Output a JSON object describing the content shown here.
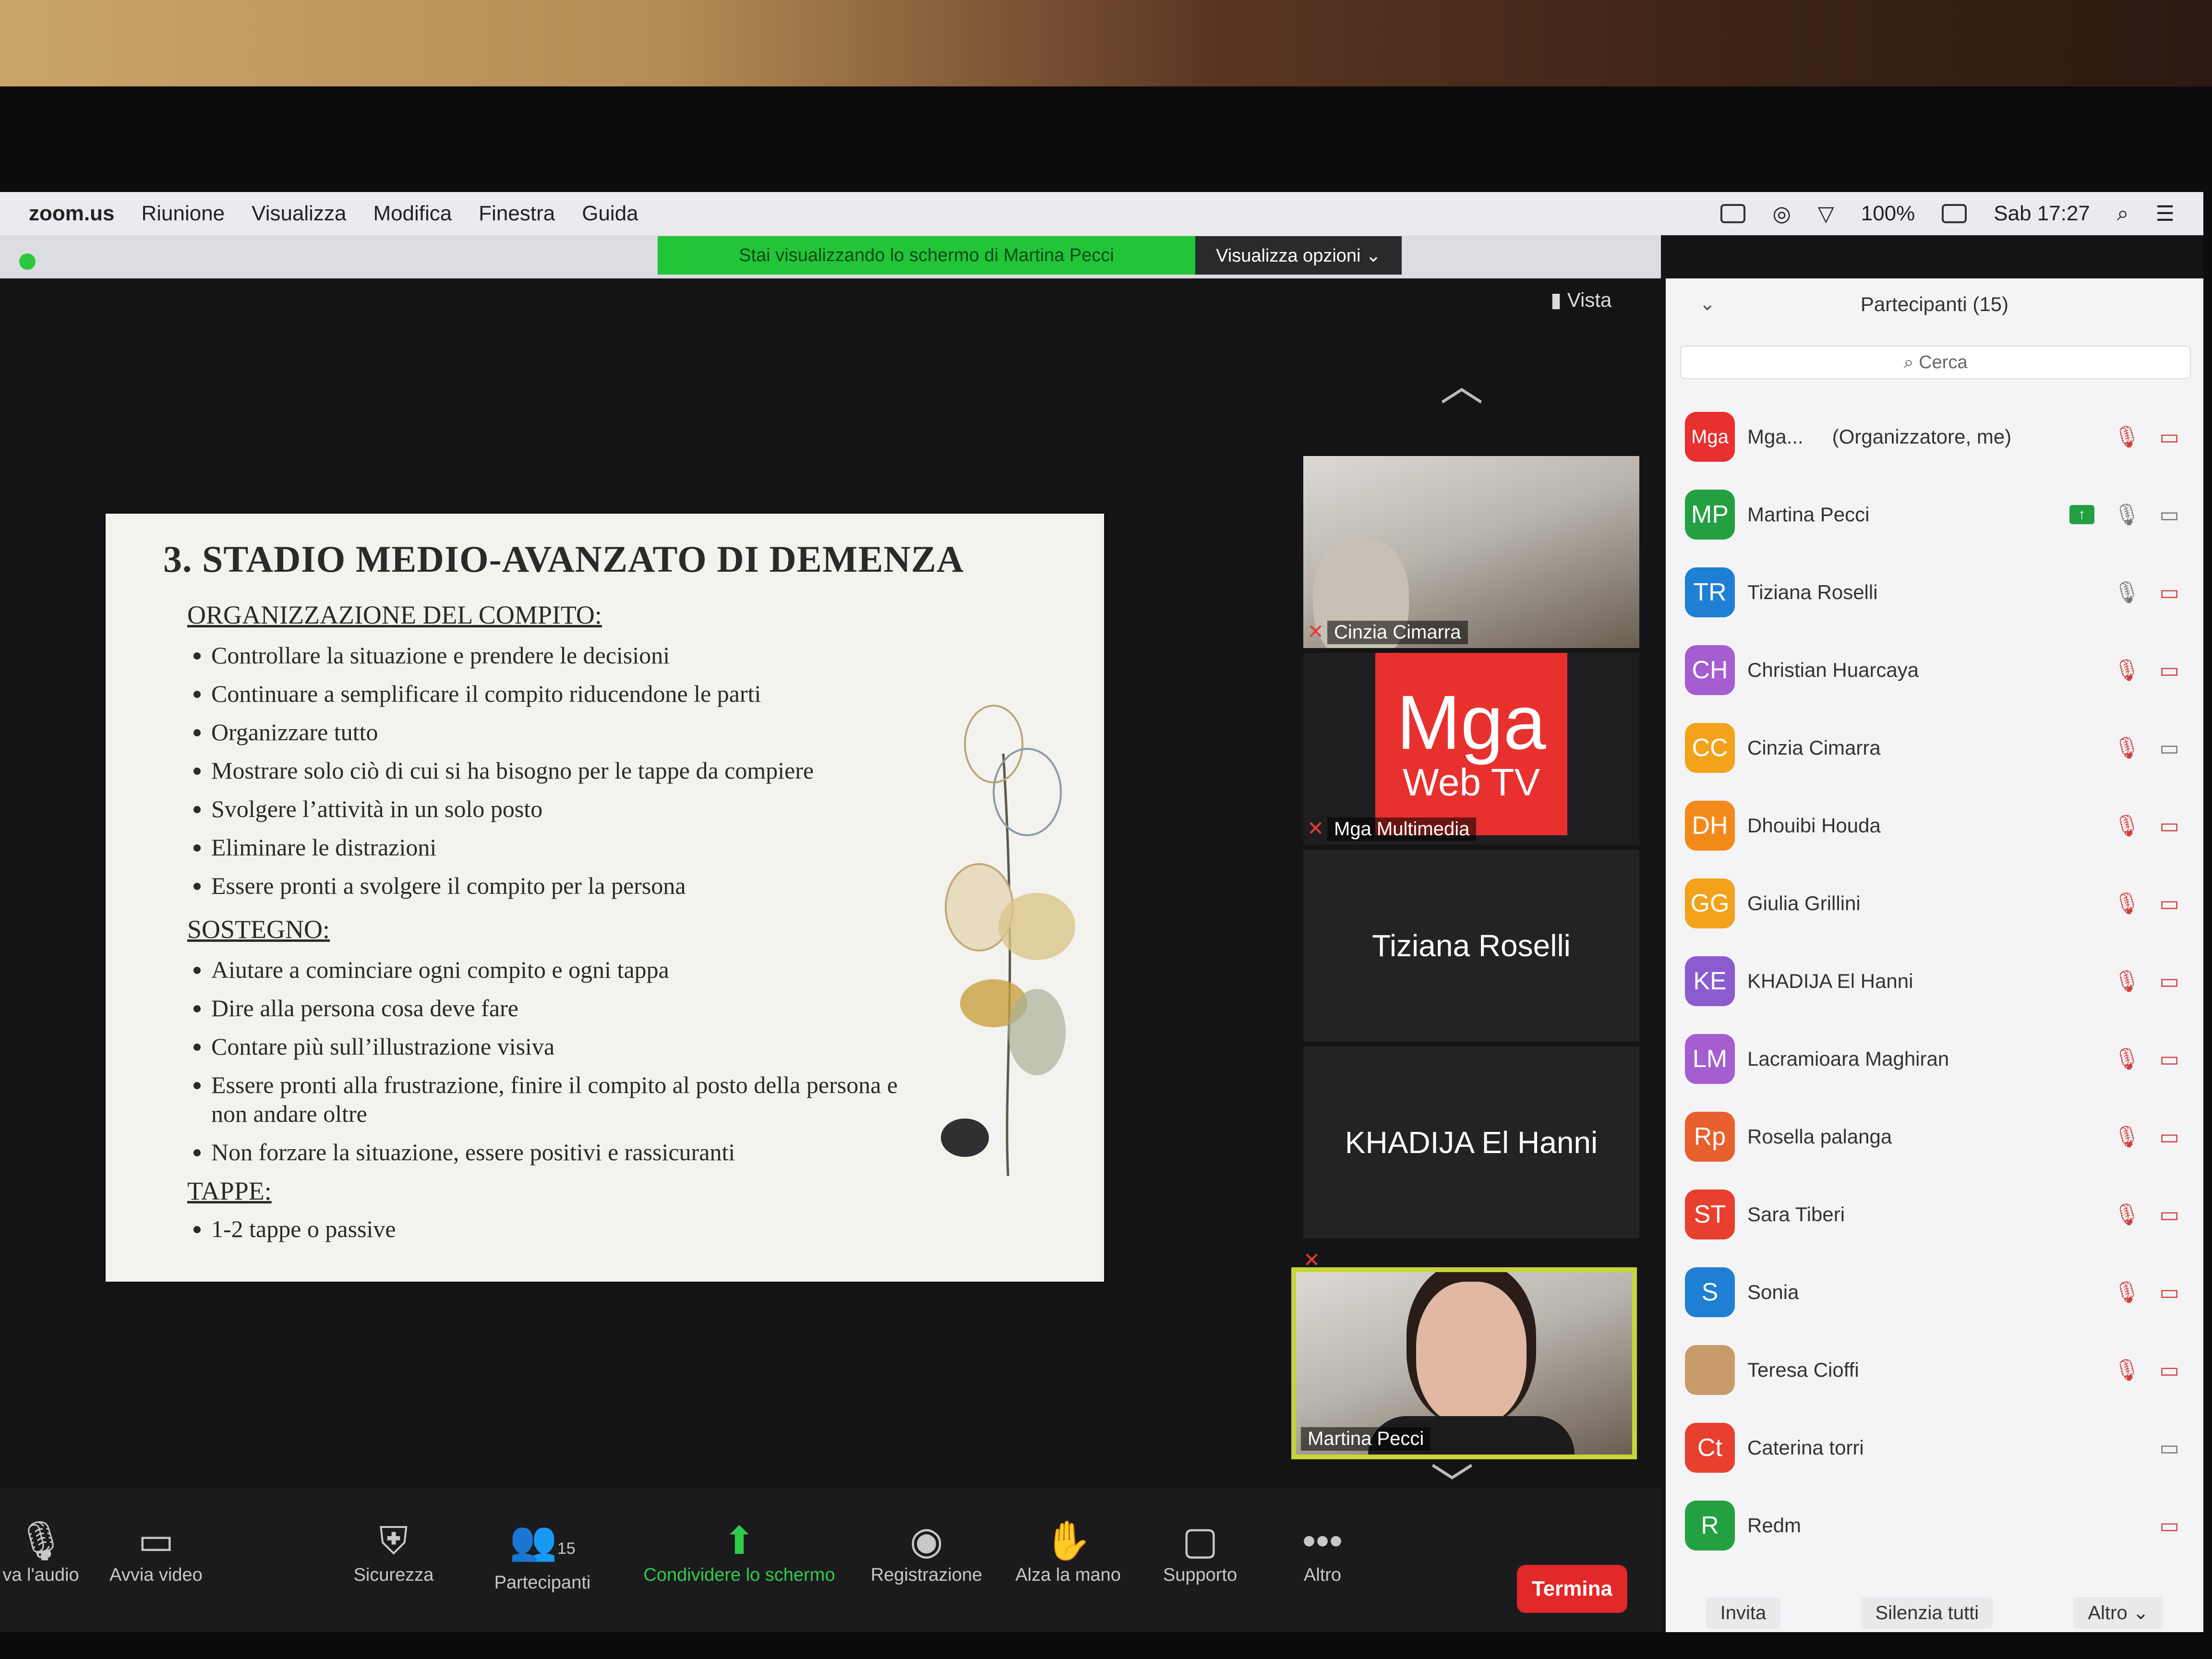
{
  "menubar": {
    "app": "zoom.us",
    "items": [
      "Riunione",
      "Visualizza",
      "Modifica",
      "Finestra",
      "Guida"
    ],
    "battery": "100%",
    "clock": "Sab 17:27"
  },
  "share_banner": "Stai visualizzando lo schermo di Martina Pecci",
  "view_options": "Visualizza opzioni ⌄",
  "vista_label": "Vista",
  "slide": {
    "title": "3. STADIO MEDIO-AVANZATO DI DEMENZA",
    "sections": [
      {
        "heading": "ORGANIZZAZIONE DEL COMPITO:",
        "bullets": [
          "Controllare la situazione e prendere le decisioni",
          "Continuare a semplificare il compito riducendone le parti",
          "Organizzare tutto",
          "Mostrare solo ciò di cui si ha bisogno per le tappe da compiere",
          "Svolgere l’attività in un solo posto",
          "Eliminare le distrazioni",
          "Essere pronti a svolgere il compito per la persona"
        ]
      },
      {
        "heading": "SOSTEGNO:",
        "bullets": [
          "Aiutare a cominciare ogni compito e ogni tappa",
          "Dire alla persona cosa deve fare",
          "Contare più sull’illustrazione visiva",
          "Essere pronti alla frustrazione, finire il compito al posto della persona e non andare oltre",
          "Non forzare la situazione, essere positivi e rassicuranti"
        ]
      },
      {
        "heading": "TAPPE:",
        "bullets": [
          "1-2 tappe o passive"
        ]
      }
    ]
  },
  "tiles": {
    "t1": "Cinzia Cimarra",
    "t2_logo_1": "Mga",
    "t2_logo_2": "Web TV",
    "t2": "Mga Multimedia",
    "t3": "Tiziana Roselli",
    "t4": "KHADIJA El Hanni",
    "t5": "Martina Pecci"
  },
  "panel": {
    "title": "Partecipanti (15)",
    "search_placeholder": "Cerca",
    "participants": [
      {
        "initials": "Mga",
        "name": "Mga...",
        "role": "(Organizzatore, me)",
        "color": "#e8302e"
      },
      {
        "initials": "MP",
        "name": "Martina Pecci",
        "color": "#23a042"
      },
      {
        "initials": "TR",
        "name": "Tiziana Roselli",
        "color": "#1f7fd4"
      },
      {
        "initials": "CH",
        "name": "Christian Huarcaya",
        "color": "#a45ed0"
      },
      {
        "initials": "CC",
        "name": "Cinzia Cimarra",
        "color": "#f2a21b"
      },
      {
        "initials": "DH",
        "name": "Dhouibi Houda",
        "color": "#f28a1b"
      },
      {
        "initials": "GG",
        "name": "Giulia Grillini",
        "color": "#f2a21b"
      },
      {
        "initials": "KE",
        "name": "KHADIJA El Hanni",
        "color": "#8a5cd0"
      },
      {
        "initials": "LM",
        "name": "Lacramioara Maghiran",
        "color": "#a45ed0"
      },
      {
        "initials": "Rp",
        "name": "Rosella palanga",
        "color": "#e8602e"
      },
      {
        "initials": "ST",
        "name": "Sara Tiberi",
        "color": "#e8402e"
      },
      {
        "initials": "S",
        "name": "Sonia",
        "color": "#1f7fd4"
      },
      {
        "initials": "",
        "name": "Teresa Cioffi",
        "color": "#c89c6a"
      },
      {
        "initials": "Ct",
        "name": "Caterina torri",
        "color": "#e8402e"
      },
      {
        "initials": "R",
        "name": "Redm",
        "color": "#23a042"
      }
    ],
    "footer": [
      "Invita",
      "Silenzia tutti",
      "Altro ⌄"
    ]
  },
  "toolbar": {
    "audio": "va l'audio",
    "video": "Avvia video",
    "security": "Sicurezza",
    "participants": "Partecipanti",
    "participants_count": "15",
    "share": "Condividere lo schermo",
    "record": "Registrazione",
    "hand": "Alza la mano",
    "support": "Supporto",
    "more": "Altro",
    "end": "Termina"
  }
}
